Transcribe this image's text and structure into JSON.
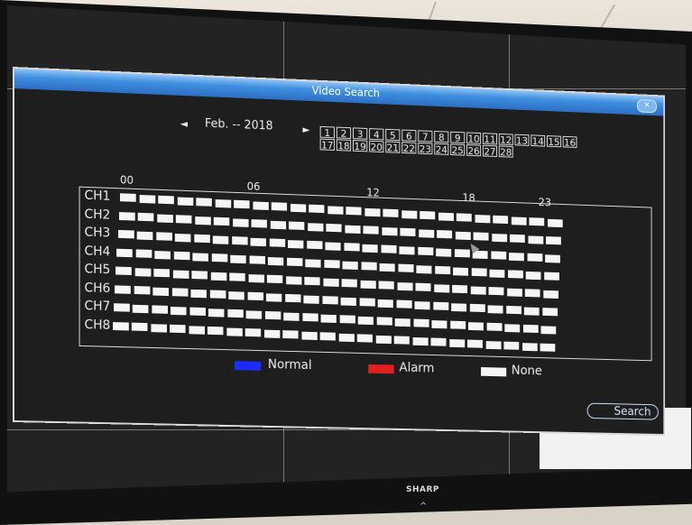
{
  "window": {
    "title": "Video Search",
    "close_icon": "close-icon"
  },
  "date_nav": {
    "prev_glyph": "◄",
    "month_year": "Feb. -- 2018",
    "next_glyph": "►",
    "days": [
      "1",
      "2",
      "3",
      "4",
      "5",
      "6",
      "7",
      "8",
      "9",
      "10",
      "11",
      "12",
      "13",
      "14",
      "15",
      "16",
      "17",
      "18",
      "19",
      "20",
      "21",
      "22",
      "23",
      "24",
      "25",
      "26",
      "27",
      "28"
    ]
  },
  "timeline": {
    "hours": [
      "00",
      "06",
      "12",
      "18",
      "23"
    ],
    "channels": [
      "CH1",
      "CH2",
      "CH3",
      "CH4",
      "CH5",
      "CH6",
      "CH7",
      "CH8"
    ],
    "slot_state": "None"
  },
  "legend": {
    "normal": {
      "label": "Normal",
      "color": "#1a2cff"
    },
    "alarm": {
      "label": "Alarm",
      "color": "#e02020"
    },
    "none": {
      "label": "None",
      "color": "#f5f5f5"
    }
  },
  "actions": {
    "search_label": "Search"
  },
  "tv": {
    "brand": "SHARP"
  }
}
